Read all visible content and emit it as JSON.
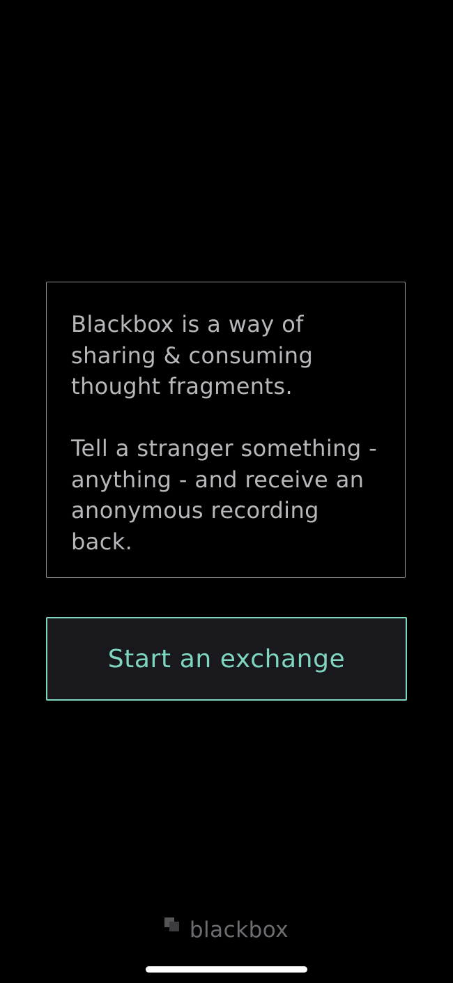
{
  "intro": {
    "paragraph_1": "Blackbox is a way of sharing & consuming thought fragments.",
    "paragraph_2": "Tell a stranger something - anything - and receive an anonymous recording back."
  },
  "start_button": {
    "label": "Start an exchange"
  },
  "brand": {
    "name": "blackbox",
    "logo_icon": "stacked-squares-icon"
  },
  "colors": {
    "background": "#000000",
    "accent": "#7fd6c0",
    "body_text": "#b8b8bc",
    "button_background": "#19181c",
    "muted": "#6e6e72"
  }
}
